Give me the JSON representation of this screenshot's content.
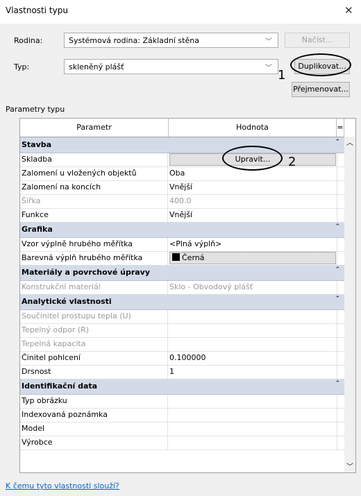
{
  "window": {
    "title": "Vlastnosti typu",
    "close_glyph": "✕"
  },
  "form": {
    "family_label": "Rodina:",
    "family_value": "Systémová rodina: Základní stěna",
    "type_label": "Typ:",
    "type_value": "skleněný plášť",
    "load_button": "Načíst...",
    "duplicate_button": "Duplikovat...",
    "rename_button": "Přejmenovat..."
  },
  "annotations": {
    "mark1": "1",
    "mark2": "2"
  },
  "section_label": "Parametry typu",
  "table": {
    "col_param": "Parametr",
    "col_value": "Hodnota",
    "col_eq": "=",
    "groups": [
      {
        "title": "Stavba",
        "rows": [
          {
            "p": "Skladba",
            "v": "Upravit...",
            "kind": "button"
          },
          {
            "p": "Zalomení u vložených objektů",
            "v": "Oba"
          },
          {
            "p": "Zalomení na koncích",
            "v": "Vnější"
          },
          {
            "p": "Šířka",
            "v": "400.0",
            "gray": true
          },
          {
            "p": "Funkce",
            "v": "Vnější"
          }
        ]
      },
      {
        "title": "Grafika",
        "rows": [
          {
            "p": "Vzor výplně hrubého měřítka",
            "v": "<Plná výplň>"
          },
          {
            "p": "Barevná výplň hrubého měřítka",
            "v": "Černá",
            "kind": "color"
          }
        ]
      },
      {
        "title": "Materiály a povrchové úpravy",
        "rows": [
          {
            "p": "Konstrukční materiál",
            "v": "Sklo - Obvodový plášť",
            "gray": true
          }
        ]
      },
      {
        "title": "Analytické vlastnosti",
        "rows": [
          {
            "p": "Součinitel prostupu tepla (U)",
            "v": "",
            "gray": true
          },
          {
            "p": "Tepelný odpor (R)",
            "v": "",
            "gray": true
          },
          {
            "p": "Tepelná kapacita",
            "v": "",
            "gray": true
          },
          {
            "p": "Činitel pohlcení",
            "v": "0.100000"
          },
          {
            "p": "Drsnost",
            "v": "1"
          }
        ]
      },
      {
        "title": "Identifikační data",
        "rows": [
          {
            "p": "Typ obrázku",
            "v": ""
          },
          {
            "p": "Indexovaná poznámka",
            "v": ""
          },
          {
            "p": "Model",
            "v": ""
          },
          {
            "p": "Výrobce",
            "v": ""
          }
        ]
      }
    ]
  },
  "footer_link": "K čemu tyto vlastnosti slouží?"
}
